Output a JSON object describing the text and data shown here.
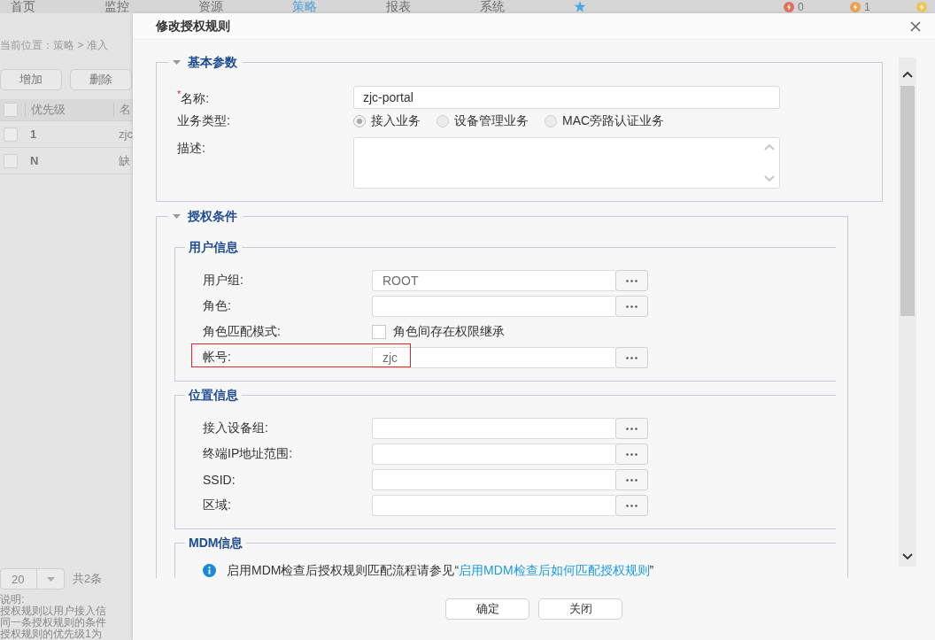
{
  "background_page": {
    "nav_tabs": [
      {
        "label": "首页",
        "selected": false
      },
      {
        "label": "监控",
        "selected": false
      },
      {
        "label": "资源",
        "selected": false
      },
      {
        "label": "策略",
        "selected": true
      },
      {
        "label": "报表",
        "selected": false
      },
      {
        "label": "系统",
        "selected": false
      }
    ],
    "alerts": [
      {
        "color": "#e0705e",
        "count": "0"
      },
      {
        "color": "#e9a24e",
        "count": "1"
      },
      {
        "color": "#e8c85a"
      }
    ],
    "breadcrumb": "当前位置：策略 > 准入",
    "toolbar_buttons": [
      "增加",
      "删除"
    ],
    "table": {
      "select_all": false,
      "columns": [
        "优先级",
        "名"
      ],
      "rows": [
        {
          "checked": false,
          "cells": [
            "1",
            "zjc"
          ]
        },
        {
          "checked": false,
          "cells": [
            "N",
            "缺"
          ]
        }
      ]
    },
    "pagination": {
      "page_size": "20",
      "total": "共2条"
    },
    "notes": [
      "说明:",
      "授权规则以用户接入信",
      "同一条授权规则的条件",
      "授权规则的优先级1为"
    ]
  },
  "dialog": {
    "title": "修改授权规则",
    "basic_params": {
      "title": "基本参数",
      "expanded": true,
      "name": {
        "label": "$^{*}$名称:",
        "value": "zjc-portal"
      },
      "business_type": {
        "label": "业务类型:",
        "options": [
          {
            "label": "接入业务",
            "selected": true
          },
          {
            "label": "设备管理业务",
            "selected": false
          },
          {
            "label": "MAC旁路认证业务",
            "selected": false
          }
        ]
      },
      "description": {
        "label": "描述:"
      }
    },
    "auth_conditions": {
      "title": "授权条件",
      "expanded": true,
      "groups": [
        {
          "title": "用户信息",
          "rows": [
            {
              "kind": "browse",
              "label": "用户组:",
              "value": "ROOT",
              "highlighted": false
            },
            {
              "kind": "browse",
              "label": "角色:",
              "highlighted": false
            },
            {
              "kind": "checkbox",
              "label": "角色匹配模式:",
              "option": "角色间存在权限继承",
              "checked": false,
              "highlighted": false
            },
            {
              "kind": "browse",
              "label": "帐号:",
              "value": "zjc",
              "highlighted": true
            }
          ]
        },
        {
          "title": "位置信息",
          "rows": [
            {
              "kind": "browse",
              "label": "接入设备组:",
              "highlighted": false
            },
            {
              "kind": "browse",
              "label": "终端IP地址范围:",
              "highlighted": false
            },
            {
              "kind": "browse",
              "label": "SSID:",
              "highlighted": false
            },
            {
              "kind": "browse",
              "label": "区域:",
              "highlighted": false
            }
          ]
        },
        {
          "title": "MDM信息",
          "rows": [
            {
              "kind": "info",
              "text": "启用MDM检查后授权规则匹配流程请参见“",
              "link": "启用MDM检查后如何匹配授权规则",
              "text_after": "”",
              "highlighted": false
            }
          ]
        }
      ]
    },
    "buttons": [
      {
        "label": "确定"
      },
      {
        "label": "关闭"
      }
    ]
  }
}
